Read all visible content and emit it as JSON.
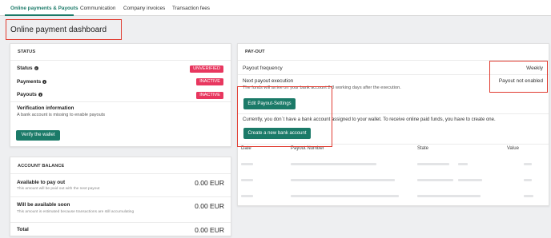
{
  "tabs": [
    {
      "label": "Online payments & Payouts",
      "active": true
    },
    {
      "label": "Communication",
      "active": false
    },
    {
      "label": "Company invoices",
      "active": false
    },
    {
      "label": "Transaction fees",
      "active": false
    }
  ],
  "page_title": "Online payment dashboard",
  "status_card": {
    "title": "STATUS",
    "rows": [
      {
        "label": "Status",
        "badge": "UNVERIFIED"
      },
      {
        "label": "Payments",
        "badge": "INACTIVE"
      },
      {
        "label": "Payouts",
        "badge": "INACTIVE"
      }
    ],
    "verification_title": "Verification information",
    "verification_text": "A bank account is missing to enable payouts",
    "verify_button": "Verify the wallet"
  },
  "balance_card": {
    "title": "ACCOUNT BALANCE",
    "available_label": "Available to pay out",
    "available_note": "This amount will be paid out with the next payout",
    "available_amount": "0.00 EUR",
    "soon_label": "Will be available soon",
    "soon_note": "This amount is estimated because transactions are still accumulating",
    "soon_amount": "0.00 EUR",
    "total_label": "Total",
    "total_amount": "0.00 EUR"
  },
  "payout_card": {
    "title": "PAY-OUT",
    "frequency_label": "Payout frequency",
    "frequency_value": "Weekly",
    "next_label": "Next payout execution",
    "next_value": "Payout not enabled",
    "funds_note": "The funds will arrive on your bank account 2-3 working days after the execution.",
    "edit_button": "Edit Payout-Settings",
    "no_bank_text": "Currently, you don´t have a bank account assigned to your wallet. To receive online paid funds, you have to create one.",
    "create_button": "Create a new bank account"
  },
  "payout_table": {
    "headers": [
      "Date",
      "Payout Number",
      "State",
      "Value"
    ]
  },
  "colors": {
    "accent": "#1b7a68",
    "badge": "#e8375f",
    "highlight": "#e03c31"
  }
}
